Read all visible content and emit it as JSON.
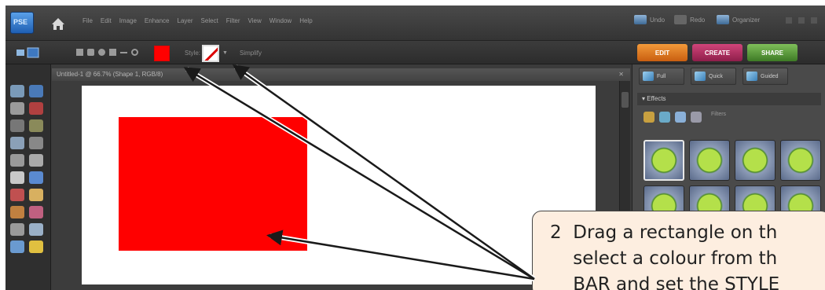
{
  "app": {
    "logo_text": "PSE",
    "menus": [
      "File",
      "Edit",
      "Image",
      "Enhance",
      "Layer",
      "Select",
      "Filter",
      "View",
      "Window",
      "Help"
    ],
    "undo_label": "Undo",
    "redo_label": "Redo",
    "organizer_label": "Organizer"
  },
  "options_bar": {
    "shape_color": "#ff0000",
    "style_label": "Style:",
    "simplify_label": "Simplify"
  },
  "mode_tabs": [
    "EDIT",
    "CREATE",
    "SHARE"
  ],
  "document": {
    "title": "Untitled-1 @ 66.7% (Shape 1, RGB/8)",
    "rectangle_color": "#ff0000"
  },
  "panel": {
    "tabs": [
      "Full",
      "Quick",
      "Guided"
    ],
    "section": "Effects",
    "filter_label": "Filters"
  },
  "callout": {
    "line1": "2  Drag a rectangle on th",
    "line2": "    select a colour from th",
    "line3": "    BAR and set the STYLE"
  }
}
